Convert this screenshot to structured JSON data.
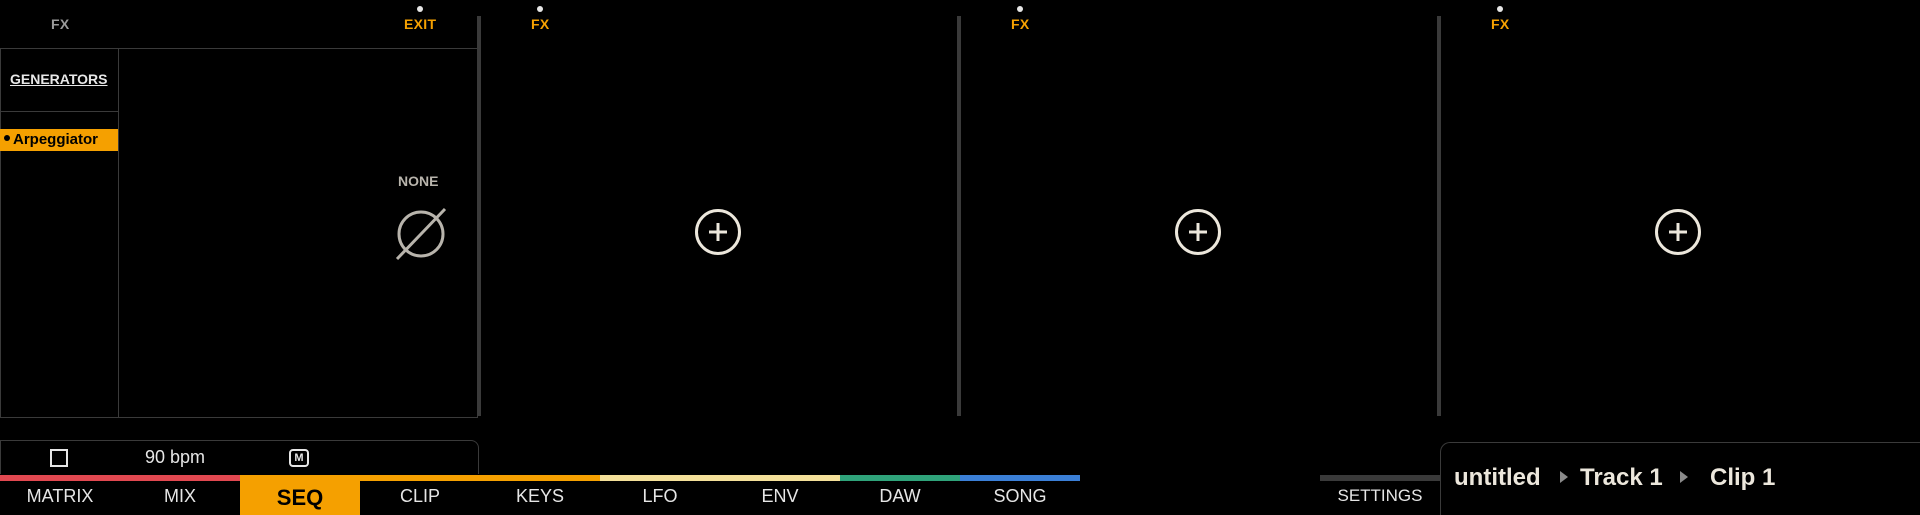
{
  "columns": [
    {
      "fx_label": "FX",
      "exit_label": "EXIT"
    },
    {
      "fx_label": "FX"
    },
    {
      "fx_label": "FX"
    },
    {
      "fx_label": "FX"
    }
  ],
  "device_panel": {
    "section_title": "GENERATORS",
    "selected_generator": "Arpeggiator",
    "empty_slot_label": "NONE",
    "empty_slot_icon": "empty-set-icon"
  },
  "transport": {
    "bpm_label": "90 bpm",
    "metronome_label": "M"
  },
  "nav": {
    "tabs": [
      {
        "label": "MATRIX",
        "color": "#e14850"
      },
      {
        "label": "MIX",
        "color": "#e14850"
      },
      {
        "label": "SEQ",
        "color": "#f5a000",
        "active": true
      },
      {
        "label": "CLIP",
        "color": "#f5a000"
      },
      {
        "label": "KEYS",
        "color": "#f5a000"
      },
      {
        "label": "LFO",
        "color": "#f4e09a"
      },
      {
        "label": "ENV",
        "color": "#f4e09a"
      },
      {
        "label": "DAW",
        "color": "#2fa37a"
      },
      {
        "label": "SONG",
        "color": "#3b7fd6"
      }
    ],
    "settings_label": "SETTINGS"
  },
  "breadcrumb": {
    "project": "untitled",
    "track": "Track 1",
    "clip": "Clip 1"
  },
  "colors": {
    "accent": "#f5a000",
    "text_light": "#ece7dc",
    "muted": "#b8b4ac"
  }
}
